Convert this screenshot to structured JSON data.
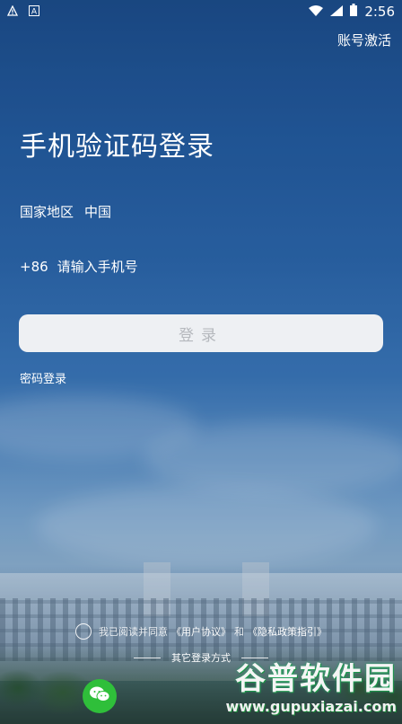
{
  "status_bar": {
    "time": "2:56",
    "icons": [
      "alert-icon",
      "text-a-icon",
      "wifi-icon",
      "signal-icon",
      "battery-icon"
    ]
  },
  "header": {
    "activate_account": "账号激活"
  },
  "main": {
    "title": "手机验证码登录",
    "region_label": "国家地区",
    "region_value": "中国",
    "country_code": "+86",
    "phone_placeholder": "请输入手机号",
    "login_button": "登录",
    "password_login": "密码登录"
  },
  "footer": {
    "agree_prefix": "我已阅读并同意",
    "user_agreement": "《用户协议》",
    "and": "和",
    "privacy_policy": "《隐私政策指引》",
    "other_login": "其它登录方式",
    "wechat_icon": "wechat-icon"
  },
  "watermark": {
    "title": "谷普软件园",
    "url": "www.gupuxiazai.com"
  },
  "colors": {
    "primary_bg": "#1f4f8a",
    "button_bg": "#eef0f3",
    "button_text": "#b5b8bd",
    "wechat_green": "#2fbf3a"
  }
}
